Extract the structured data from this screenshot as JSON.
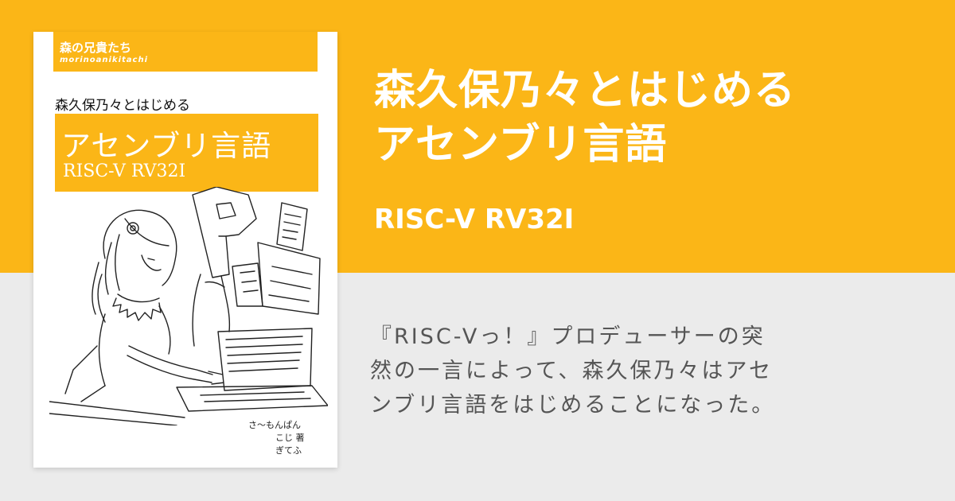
{
  "colors": {
    "accent": "#fbb617",
    "background": "#ebebeb",
    "text_muted": "#555555"
  },
  "cover": {
    "circle_name": "森の兄貴たち",
    "circle_roman": "morinoanikitachi",
    "subtitle": "森久保乃々とはじめる",
    "title": "アセンブリ言語",
    "edition": "RISC-V RV32I",
    "authors": [
      "さ〜もんぱん",
      "こじ 著",
      "ぎてふ"
    ]
  },
  "headline": {
    "line1": "森久保乃々とはじめる",
    "line2": "アセンブリ言語",
    "edition": "RISC-V RV32I"
  },
  "description": {
    "lines": [
      "『RISC-Vっ！』プロデューサーの突",
      "然の一言によって、森久保乃々はアセ",
      "ンブリ言語をはじめることになった。"
    ]
  }
}
